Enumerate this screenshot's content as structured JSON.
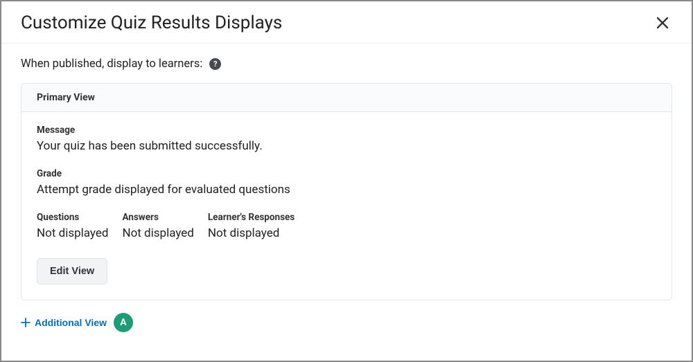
{
  "header": {
    "title": "Customize Quiz Results Displays"
  },
  "intro": {
    "label": "When published, display to learners:"
  },
  "panel": {
    "title": "Primary View",
    "message_label": "Message",
    "message_value": "Your quiz has been submitted successfully.",
    "grade_label": "Grade",
    "grade_value": "Attempt grade displayed for evaluated questions",
    "columns": {
      "questions_label": "Questions",
      "questions_value": "Not displayed",
      "answers_label": "Answers",
      "answers_value": "Not displayed",
      "responses_label": "Learner's Responses",
      "responses_value": "Not displayed"
    },
    "edit_button_label": "Edit View"
  },
  "add_view": {
    "label": "Additional View"
  },
  "annotation": {
    "marker": "A"
  }
}
